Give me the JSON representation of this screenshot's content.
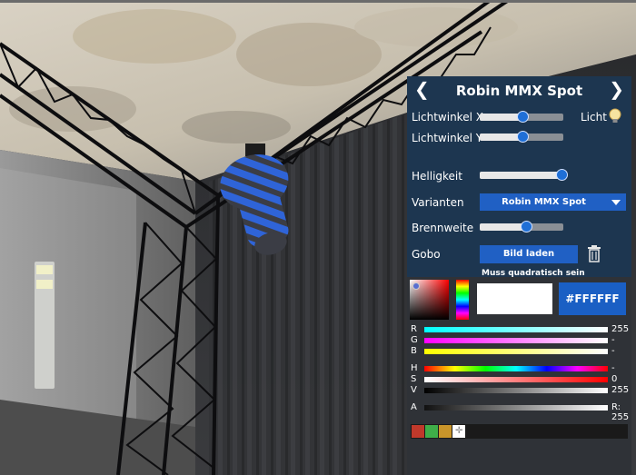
{
  "panel": {
    "title": "Robin MMX Spot",
    "prev_arrow": "❮",
    "next_arrow": "❯",
    "tilt_x_label": "Lichtwinkel X",
    "tilt_y_label": "Lichtwinkel Y",
    "light_label": "Licht",
    "brightness_label": "Helligkeit",
    "variants_label": "Varianten",
    "variant_value": "Robin MMX Spot",
    "focal_label": "Brennweite",
    "gobo_label": "Gobo",
    "load_image_label": "Bild laden",
    "square_note": "Muss quadratisch sein",
    "sliders": {
      "tilt_x": 0.51,
      "tilt_y": 0.51,
      "brightness": 0.98,
      "focal": 0.55
    }
  },
  "color_picker": {
    "hex_value": "#FFFFFF",
    "preview_color": "#ffffff",
    "rows": [
      {
        "label": "R",
        "value": "255"
      },
      {
        "label": "G",
        "value": "-"
      },
      {
        "label": "B",
        "value": "-"
      },
      {
        "label": "H",
        "value": "-"
      },
      {
        "label": "S",
        "value": "0"
      },
      {
        "label": "V",
        "value": "255"
      },
      {
        "label": "A",
        "value": "R:"
      },
      {
        "label": "",
        "value": "255"
      }
    ],
    "swatches": [
      "#c0392b",
      "#3fae49",
      "#c9952a",
      "#ffffff"
    ]
  }
}
